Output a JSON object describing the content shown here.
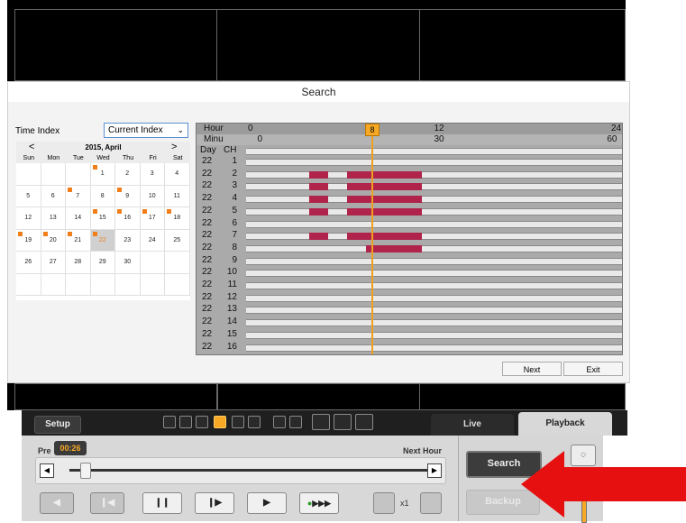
{
  "dialog": {
    "title": "Search",
    "time_index_label": "Time Index",
    "time_index_value": "Current Index",
    "next_label": "Next",
    "exit_label": "Exit"
  },
  "calendar": {
    "month_label": "2015, April",
    "prev_icon": "<",
    "next_icon": ">",
    "weekdays": [
      "Sun",
      "Mon",
      "Tue",
      "Wed",
      "Thu",
      "Fri",
      "Sat"
    ],
    "weeks": [
      [
        "",
        "",
        "",
        "1",
        "2",
        "3",
        "4"
      ],
      [
        "5",
        "6",
        "7",
        "8",
        "9",
        "10",
        "11"
      ],
      [
        "12",
        "13",
        "14",
        "15",
        "16",
        "17",
        "18"
      ],
      [
        "19",
        "20",
        "21",
        "22",
        "23",
        "24",
        "25"
      ],
      [
        "26",
        "27",
        "28",
        "29",
        "30",
        "",
        ""
      ],
      [
        "",
        "",
        "",
        "",
        "",
        "",
        ""
      ]
    ],
    "recorded_days": [
      "1",
      "7",
      "9",
      "15",
      "16",
      "17",
      "18",
      "19",
      "20",
      "21",
      "22"
    ],
    "selected_day": "22"
  },
  "timeline": {
    "hour_label": "Hour",
    "minute_label": "Minu",
    "day_label": "Day",
    "ch_label": "CH",
    "hour_ticks": [
      "0",
      "12",
      "24"
    ],
    "minute_ticks": [
      "0",
      "30",
      "60"
    ],
    "cursor_value": "8",
    "rows": [
      {
        "day": "22",
        "ch": "1",
        "segments": []
      },
      {
        "day": "22",
        "ch": "2",
        "segments": [
          [
            4.05,
            5.25
          ],
          [
            6.45,
            11.25
          ]
        ]
      },
      {
        "day": "22",
        "ch": "3",
        "segments": [
          [
            4.05,
            5.25
          ],
          [
            6.45,
            11.25
          ]
        ]
      },
      {
        "day": "22",
        "ch": "4",
        "segments": [
          [
            4.05,
            5.25
          ],
          [
            6.45,
            11.25
          ]
        ]
      },
      {
        "day": "22",
        "ch": "5",
        "segments": [
          [
            4.05,
            5.25
          ],
          [
            6.45,
            11.25
          ]
        ]
      },
      {
        "day": "22",
        "ch": "6",
        "segments": []
      },
      {
        "day": "22",
        "ch": "7",
        "segments": [
          [
            4.05,
            5.25
          ],
          [
            6.45,
            11.25
          ]
        ]
      },
      {
        "day": "22",
        "ch": "8",
        "segments": [
          [
            7.65,
            11.25
          ]
        ]
      },
      {
        "day": "22",
        "ch": "9",
        "segments": []
      },
      {
        "day": "22",
        "ch": "10",
        "segments": []
      },
      {
        "day": "22",
        "ch": "11",
        "segments": []
      },
      {
        "day": "22",
        "ch": "12",
        "segments": []
      },
      {
        "day": "22",
        "ch": "13",
        "segments": []
      },
      {
        "day": "22",
        "ch": "14",
        "segments": []
      },
      {
        "day": "22",
        "ch": "15",
        "segments": []
      },
      {
        "day": "22",
        "ch": "16",
        "segments": []
      }
    ],
    "cursor_hour": 8
  },
  "toolbar": {
    "setup_label": "Setup",
    "live_tab": "Live",
    "playback_tab": "Playback",
    "view_icons": [
      "single-view-icon",
      "quad-view-icon",
      "nine-view-icon",
      "sixteen-view-icon",
      "twentyfive-view-icon",
      "thirtytwo-view-icon",
      "undo-icon",
      "zoom-icon",
      "snapshot-icon",
      "fullscreen-icon",
      "eraser-icon"
    ]
  },
  "playback": {
    "prev_label": "Pre",
    "time_badge": "00:26",
    "next_label": "Next Hour",
    "speed_label": "x1",
    "search_label": "Search",
    "backup_label": "Backup",
    "seek_position": 0.02
  },
  "colors": {
    "accent": "#f7a925",
    "record": "#b0234a",
    "recorded_marker": "#f07e1b",
    "arrow": "#e61010"
  }
}
